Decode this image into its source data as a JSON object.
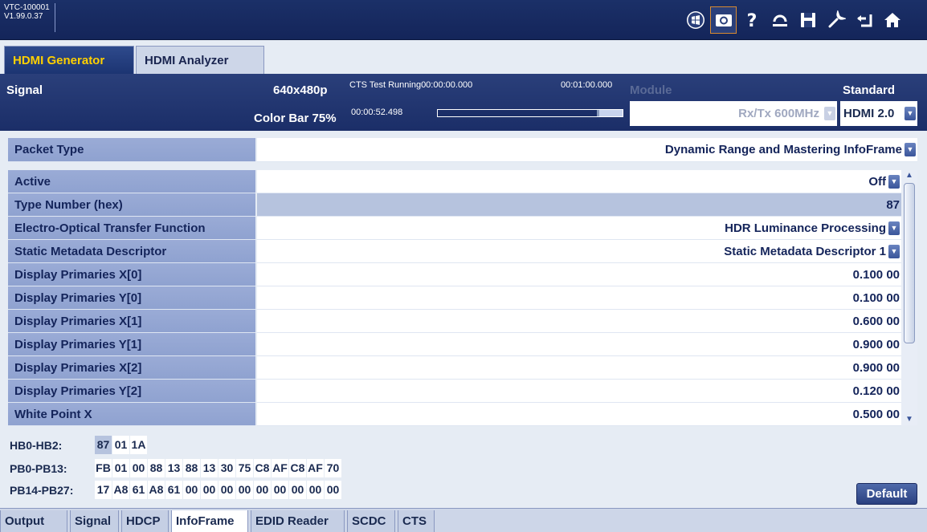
{
  "device": {
    "id": "VTC-100001",
    "version": "V1.99.0.37"
  },
  "toolbar_icons": [
    "windows-icon",
    "camera-icon",
    "help-icon",
    "undo-icon",
    "save-icon",
    "wrench-icon",
    "back-icon",
    "home-icon"
  ],
  "main_tabs": [
    "HDMI Generator",
    "HDMI Analyzer"
  ],
  "signal": {
    "label": "Signal",
    "resolution": "640x480p",
    "pattern": "Color Bar 75%",
    "cts_status": "CTS Test Running00:00:00.000",
    "cts_end": "00:01:00.000",
    "elapsed": "00:00:52.498",
    "progress": 0.87
  },
  "module": {
    "label": "Module",
    "value": "Rx/Tx 600MHz"
  },
  "standard": {
    "label": "Standard",
    "value": "HDMI 2.0"
  },
  "packet_type": {
    "label": "Packet Type",
    "value": "Dynamic Range and Mastering InfoFrame"
  },
  "rows": [
    {
      "label": "Active",
      "value": "Off",
      "dropdown": true
    },
    {
      "label": "Type Number (hex)",
      "value": "87",
      "readonly": true
    },
    {
      "label": "Electro-Optical Transfer Function",
      "value": "HDR Luminance Processing",
      "dropdown": true
    },
    {
      "label": "Static Metadata Descriptor",
      "value": "Static Metadata Descriptor 1",
      "dropdown": true
    },
    {
      "label": "Display Primaries X[0]",
      "value": "0.100 00"
    },
    {
      "label": "Display Primaries Y[0]",
      "value": "0.100 00"
    },
    {
      "label": "Display Primaries X[1]",
      "value": "0.600 00"
    },
    {
      "label": "Display Primaries Y[1]",
      "value": "0.900 00"
    },
    {
      "label": "Display Primaries X[2]",
      "value": "0.900 00"
    },
    {
      "label": "Display Primaries Y[2]",
      "value": "0.120 00"
    },
    {
      "label": "White Point X",
      "value": "0.500 00"
    }
  ],
  "hex": {
    "hb": {
      "label": "HB0-HB2:",
      "cells": [
        "87",
        "01",
        "1A"
      ]
    },
    "pb0": {
      "label": "PB0-PB13:",
      "cells": [
        "FB",
        "01",
        "00",
        "88",
        "13",
        "88",
        "13",
        "30",
        "75",
        "C8",
        "AF",
        "C8",
        "AF",
        "70"
      ]
    },
    "pb14": {
      "label": "PB14-PB27:",
      "cells": [
        "17",
        "A8",
        "61",
        "A8",
        "61",
        "00",
        "00",
        "00",
        "00",
        "00",
        "00",
        "00",
        "00",
        "00"
      ]
    }
  },
  "default_button": "Default",
  "bottom_tabs": [
    "Output",
    "Signal",
    "HDCP",
    "InfoFrame",
    "EDID Reader",
    "SCDC",
    "CTS"
  ],
  "active_bottom_tab": "InfoFrame",
  "colors": {
    "header": "#1b3068",
    "accent": "#ffd000",
    "label_bg": "#9aabd6"
  }
}
